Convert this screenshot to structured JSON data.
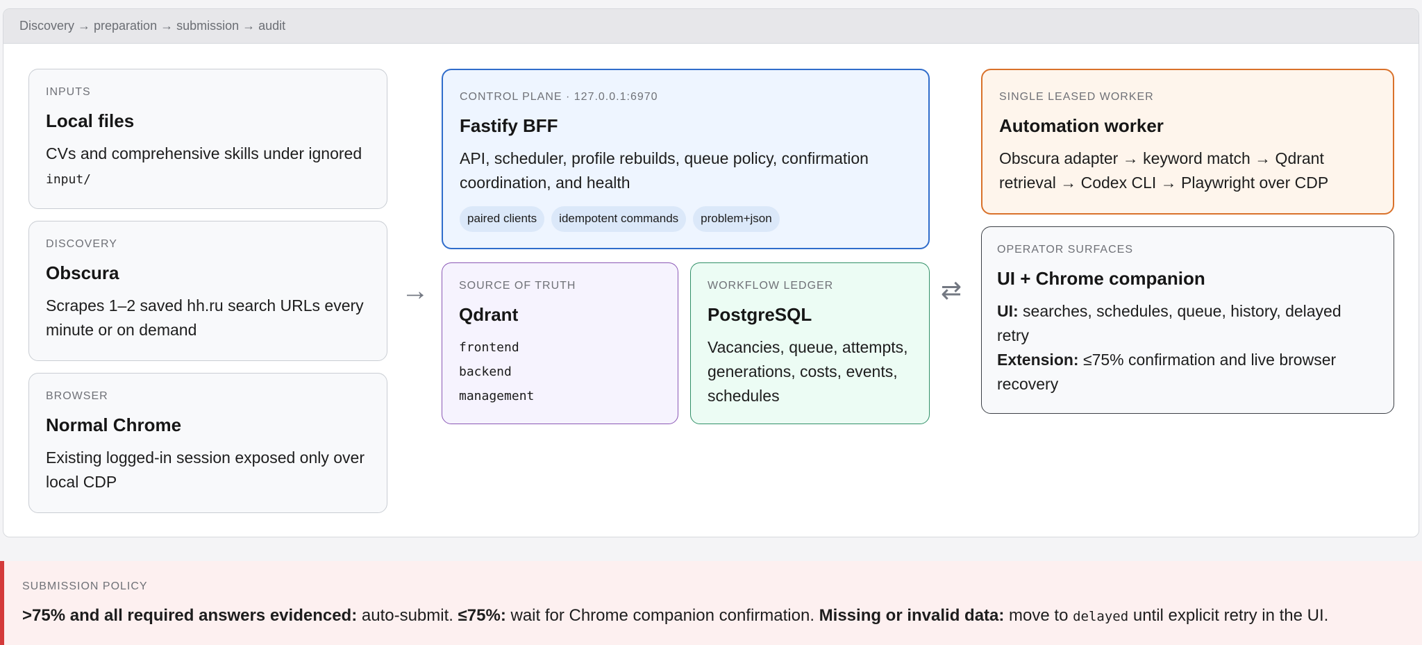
{
  "header": {
    "title": "Discovery → preparation → submission → audit"
  },
  "inputs": {
    "kicker": "INPUTS",
    "title": "Local files",
    "body": "CVs and comprehensive skills under ignored",
    "code": "input/"
  },
  "discovery": {
    "kicker": "DISCOVERY",
    "title": "Obscura",
    "body": "Scrapes 1–2 saved hh.ru search URLs every minute or on demand"
  },
  "browser": {
    "kicker": "BROWSER",
    "title": "Normal Chrome",
    "body": "Existing logged-in session exposed only over local CDP"
  },
  "control_plane": {
    "kicker": "CONTROL PLANE · 127.0.0.1:6970",
    "title": "Fastify BFF",
    "body": "API, scheduler, profile rebuilds, queue policy, confirmation coordination, and health",
    "pills": [
      "paired clients",
      "idempotent commands",
      "problem+json"
    ]
  },
  "source_of_truth": {
    "kicker": "SOURCE OF TRUTH",
    "title": "Qdrant",
    "collections": [
      "frontend",
      "backend",
      "management"
    ]
  },
  "workflow_ledger": {
    "kicker": "WORKFLOW LEDGER",
    "title": "PostgreSQL",
    "body": "Vacancies, queue, attempts, generations, costs, events, schedules"
  },
  "worker": {
    "kicker": "SINGLE LEASED WORKER",
    "title": "Automation worker",
    "body": "Obscura adapter → keyword match → Qdrant retrieval → Codex CLI → Playwright over CDP"
  },
  "operator": {
    "kicker": "OPERATOR SURFACES",
    "title": "UI + Chrome companion",
    "ui_label": "UI:",
    "ui_text": " searches, schedules, queue, history, delayed retry",
    "ext_label": "Extension:",
    "ext_text": " ≤75% confirmation and live browser recovery"
  },
  "arrows": {
    "right": "→",
    "bidirectional": "⇄"
  },
  "policy": {
    "kicker": "SUBMISSION POLICY",
    "rule1_label": ">75% and all required answers evidenced:",
    "rule1_text": " auto-submit. ",
    "rule2_label": "≤75%:",
    "rule2_text": " wait for Chrome companion confirmation. ",
    "rule3_label": "Missing or invalid data:",
    "rule3_text": " move to ",
    "rule3_code": "delayed",
    "rule3_tail": " until explicit retry in the UI."
  }
}
